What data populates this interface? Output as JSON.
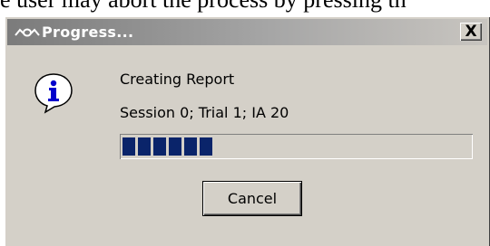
{
  "background_caption": "e user may abort the process by pressing th",
  "window": {
    "title": "Progress...",
    "close_label": "X",
    "app_icon": "window-menu-icon"
  },
  "message": {
    "icon": "info-icon",
    "line1": "Creating Report",
    "line2": "Session 0; Trial 1; IA 20"
  },
  "progress": {
    "value_fraction": 0.26,
    "filled_segments": 6,
    "color": "#0a246a"
  },
  "buttons": {
    "cancel_label": "Cancel"
  }
}
